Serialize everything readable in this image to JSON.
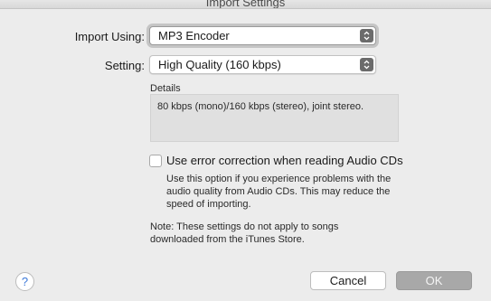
{
  "window": {
    "title": "Import Settings"
  },
  "import_using": {
    "label": "Import Using:",
    "value": "MP3 Encoder"
  },
  "setting": {
    "label": "Setting:",
    "value": "High Quality (160 kbps)"
  },
  "details": {
    "label": "Details",
    "text": "80 kbps (mono)/160 kbps (stereo), joint stereo."
  },
  "error_correction": {
    "label": "Use error correction when reading Audio CDs",
    "checked": false,
    "help_lines": [
      "Use this option if you experience problems with the",
      "audio quality from Audio CDs.  This may reduce the",
      "speed of importing."
    ]
  },
  "note": {
    "lines": [
      "Note: These settings do not apply to songs",
      "downloaded from the iTunes Store."
    ]
  },
  "buttons": {
    "help": "?",
    "cancel": "Cancel",
    "ok": "OK"
  }
}
